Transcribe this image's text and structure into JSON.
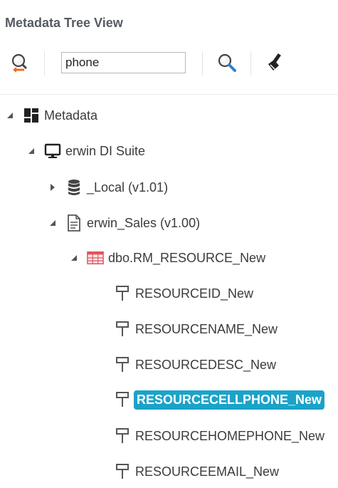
{
  "panel": {
    "title": "Metadata Tree View"
  },
  "toolbar": {
    "search_value": "phone",
    "buttons": [
      "reverse-search-icon",
      "search-icon",
      "clear-brush-icon"
    ]
  },
  "tree": {
    "root": {
      "label": "Metadata",
      "icon": "dashboard-grid-icon",
      "state": "expanded"
    },
    "suite": {
      "label": "erwin DI Suite",
      "icon": "monitor-icon",
      "state": "expanded"
    },
    "local": {
      "label": "_Local (v1.01)",
      "icon": "database-icon",
      "state": "collapsed"
    },
    "sales": {
      "label": "erwin_Sales (v1.00)",
      "icon": "document-icon",
      "state": "expanded"
    },
    "table": {
      "label": "dbo.RM_RESOURCE_New",
      "icon": "table-icon",
      "state": "expanded"
    },
    "columns": [
      {
        "label": "RESOURCEID_New",
        "icon": "column-icon",
        "selected": false
      },
      {
        "label": "RESOURCENAME_New",
        "icon": "column-icon",
        "selected": false
      },
      {
        "label": "RESOURCEDESC_New",
        "icon": "column-icon",
        "selected": false
      },
      {
        "label": "RESOURCECELLPHONE_New",
        "icon": "column-icon",
        "selected": true
      },
      {
        "label": "RESOURCEHOMEPHONE_New",
        "icon": "column-icon",
        "selected": false
      },
      {
        "label": "RESOURCEEMAIL_New",
        "icon": "column-icon",
        "selected": false
      }
    ]
  },
  "colors": {
    "selection": "#1aa3c9",
    "table_icon": "#e0555e",
    "accent_orange": "#f26b1d",
    "accent_blue": "#2f7fd0"
  }
}
